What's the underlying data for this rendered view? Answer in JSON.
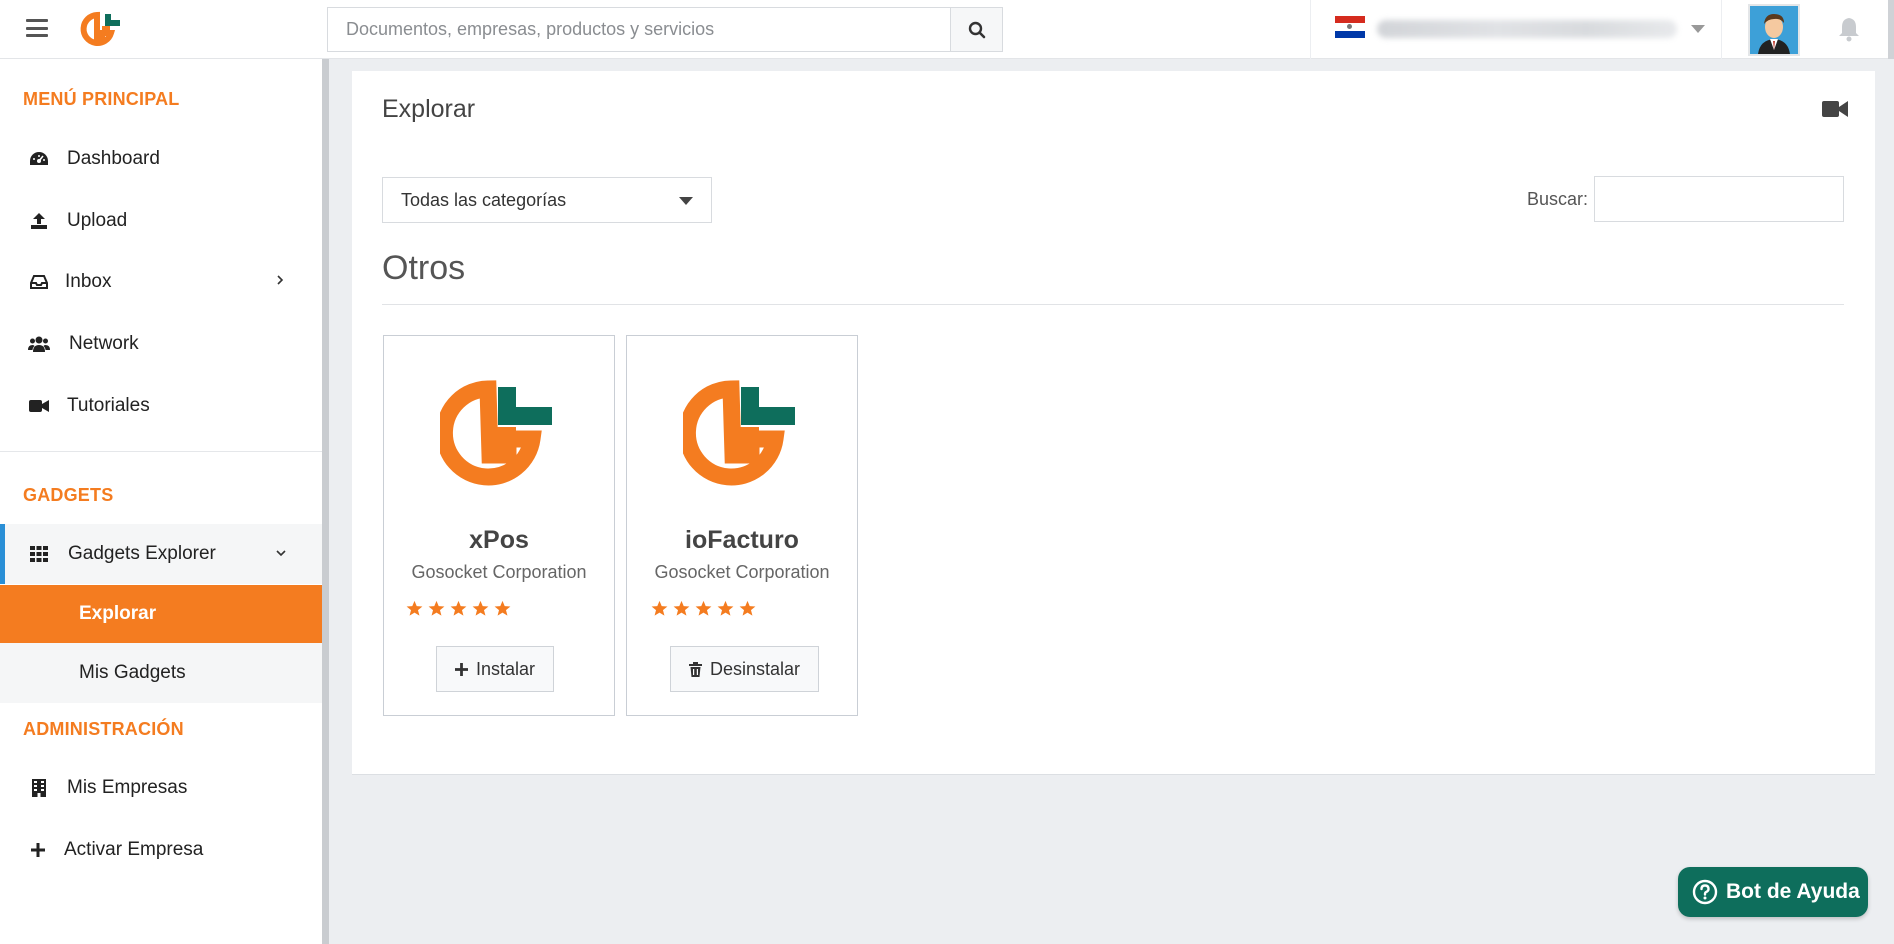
{
  "header": {
    "search_placeholder": "Documentos, empresas, productos y servicios"
  },
  "sidebar": {
    "main_title": "MENÚ PRINCIPAL",
    "main_items": [
      {
        "label": "Dashboard"
      },
      {
        "label": "Upload"
      },
      {
        "label": "Inbox"
      },
      {
        "label": "Network"
      },
      {
        "label": "Tutoriales"
      }
    ],
    "gadgets_title": "GADGETS",
    "gadgets_explorer": "Gadgets Explorer",
    "gadgets_sub": [
      {
        "label": "Explorar"
      },
      {
        "label": "Mis Gadgets"
      }
    ],
    "admin_title": "ADMINISTRACIÓN",
    "admin_items": [
      {
        "label": "Mis Empresas"
      },
      {
        "label": "Activar Empresa"
      }
    ]
  },
  "main": {
    "title": "Explorar",
    "category_select": "Todas las categorías",
    "search_label": "Buscar:",
    "section_title": "Otros",
    "cards": [
      {
        "name": "xPos",
        "vendor": "Gosocket Corporation",
        "rating": 5,
        "action": "Instalar"
      },
      {
        "name": "ioFacturo",
        "vendor": "Gosocket Corporation",
        "rating": 5,
        "action": "Desinstalar"
      }
    ]
  },
  "help_bot": {
    "label": "Bot de Ayuda"
  },
  "colors": {
    "accent": "#f47c20",
    "teal": "#0e6e5c",
    "active_border": "#2a8fd6"
  }
}
